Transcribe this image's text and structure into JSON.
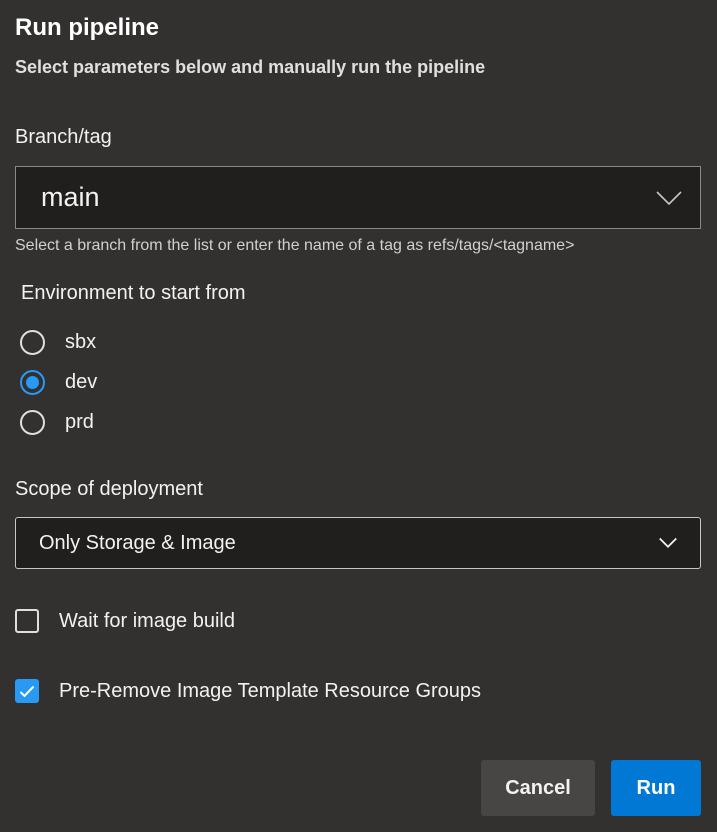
{
  "dialog": {
    "title": "Run pipeline",
    "subtitle": "Select parameters below and manually run the pipeline"
  },
  "branch": {
    "label": "Branch/tag",
    "value": "main",
    "helper": "Select a branch from the list or enter the name of a tag as refs/tags/<tagname>",
    "icon": "chevron-down-icon"
  },
  "environment": {
    "label": "Environment to start from",
    "options": [
      {
        "label": "sbx",
        "selected": false
      },
      {
        "label": "dev",
        "selected": true
      },
      {
        "label": "prd",
        "selected": false
      }
    ]
  },
  "scope": {
    "label": "Scope of deployment",
    "value": "Only Storage & Image",
    "icon": "chevron-down-icon"
  },
  "options": {
    "wait_for_image": {
      "label": "Wait for image build",
      "checked": false
    },
    "pre_remove": {
      "label": "Pre-Remove Image Template Resource Groups",
      "checked": true
    }
  },
  "actions": {
    "cancel_label": "Cancel",
    "run_label": "Run"
  },
  "colors": {
    "background": "#323130",
    "field_background": "#201f1e",
    "accent": "#2899f5",
    "primary_button": "#0078d4",
    "secondary_button": "#484644"
  }
}
